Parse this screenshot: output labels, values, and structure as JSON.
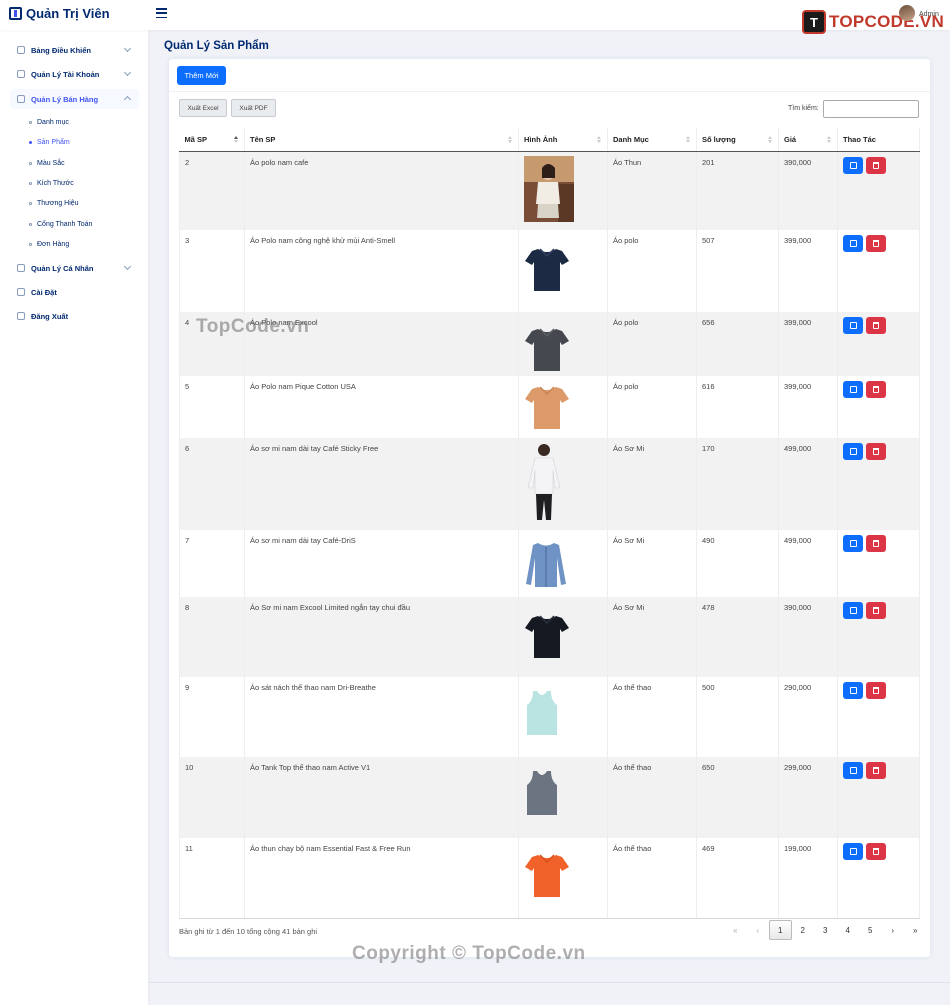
{
  "app": {
    "title": "Quản Trị Viên",
    "user": "Admin",
    "brand_logo": "TOPCODE.VN"
  },
  "sidebar": {
    "items": [
      {
        "label": "Bảng Điều Khiển",
        "icon": "dashboard-icon",
        "chevron": true
      },
      {
        "label": "Quản Lý Tài Khoản",
        "icon": "accounts-icon",
        "chevron": true
      },
      {
        "label": "Quản Lý Bán Hàng",
        "icon": "sales-icon",
        "chevron": true,
        "active": true
      },
      {
        "label": "Quản Lý Cá Nhân",
        "icon": "profile-icon",
        "chevron": true
      },
      {
        "label": "Cài Đặt",
        "icon": "gear-icon",
        "chevron": false
      },
      {
        "label": "Đăng Xuất",
        "icon": "logout-icon",
        "chevron": false
      }
    ],
    "sub_items": [
      {
        "label": "Danh mục"
      },
      {
        "label": "Sản Phẩm",
        "active": true
      },
      {
        "label": "Màu Sắc"
      },
      {
        "label": "Kích Thước"
      },
      {
        "label": "Thương Hiệu"
      },
      {
        "label": "Cổng Thanh Toán"
      },
      {
        "label": "Đơn Hàng"
      }
    ]
  },
  "page": {
    "title": "Quản Lý Sản Phẩm"
  },
  "toolbar": {
    "add_label": "Thêm Mới",
    "excel_label": "Xuất Excel",
    "pdf_label": "Xuất PDF",
    "search_label": "Tìm kiếm:",
    "search_value": ""
  },
  "table": {
    "columns": [
      "Mã SP",
      "Tên SP",
      "Hình Ảnh",
      "Danh Mục",
      "Số lượng",
      "Giá",
      "Thao Tác"
    ],
    "rows": [
      {
        "id": "2",
        "name": "Áo polo nam cafe",
        "category": "Áo Thun",
        "qty": "201",
        "price": "390,000",
        "image": "photo-woman"
      },
      {
        "id": "3",
        "name": "Áo Polo nam công nghệ khử mùi Anti-Smell",
        "category": "Áo polo",
        "qty": "507",
        "price": "399,000",
        "image": "polo-navy"
      },
      {
        "id": "4",
        "name": "Áo Polo nam Excool",
        "category": "Áo polo",
        "qty": "656",
        "price": "399,000",
        "image": "polo-charcoal"
      },
      {
        "id": "5",
        "name": "Áo Polo nam Pique Cotton USA",
        "category": "Áo polo",
        "qty": "616",
        "price": "399,000",
        "image": "polo-orange"
      },
      {
        "id": "6",
        "name": "Áo sơ mi nam dài tay Café Sticky Free",
        "category": "Áo Sơ Mi",
        "qty": "170",
        "price": "499,000",
        "image": "shirt-white-model"
      },
      {
        "id": "7",
        "name": "Áo sơ mi nam dài tay Café-DriS",
        "category": "Áo Sơ Mi",
        "qty": "490",
        "price": "499,000",
        "image": "shirt-blue"
      },
      {
        "id": "8",
        "name": "Áo Sơ mi nam Excool Limited ngắn tay chui đầu",
        "category": "Áo Sơ Mi",
        "qty": "478",
        "price": "390,000",
        "image": "polo-black"
      },
      {
        "id": "9",
        "name": "Áo sát nách thể thao nam Dri-Breathe",
        "category": "Áo thể thao",
        "qty": "500",
        "price": "290,000",
        "image": "tank-mint"
      },
      {
        "id": "10",
        "name": "Áo Tank Top thể thao nam Active V1",
        "category": "Áo thể thao",
        "qty": "650",
        "price": "299,000",
        "image": "tank-grey"
      },
      {
        "id": "11",
        "name": "Áo thun chạy bộ nam Essential Fast & Free Run",
        "category": "Áo thể thao",
        "qty": "469",
        "price": "199,000",
        "image": "tee-orange"
      }
    ]
  },
  "pagination": {
    "info": "Bản ghi từ 1 đến 10 tổng cộng 41 bản ghi",
    "first": "«",
    "prev": "‹",
    "pages": [
      "1",
      "2",
      "3",
      "4",
      "5"
    ],
    "current": "1",
    "next": "›",
    "last": "»"
  },
  "watermark": "TopCode.vn",
  "copyright": "Copyright © TopCode.vn",
  "colors": {
    "primary": "#0d6efd",
    "danger": "#dc3545",
    "brand": "#012970",
    "accent": "#4154f1"
  }
}
